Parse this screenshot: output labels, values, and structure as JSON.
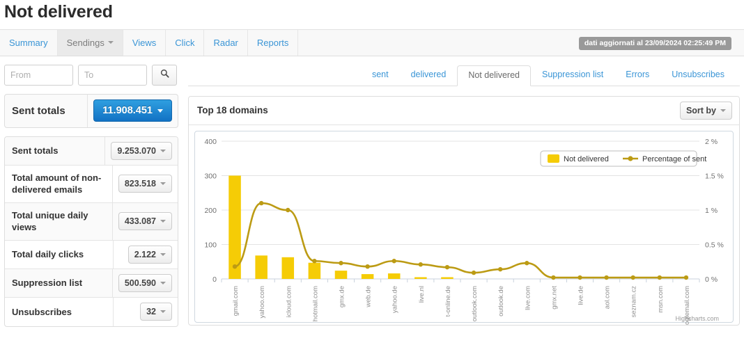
{
  "page": {
    "title": "Not delivered"
  },
  "navbar": {
    "tabs": [
      {
        "label": "Summary",
        "active": false,
        "caret": false
      },
      {
        "label": "Sendings",
        "active": true,
        "caret": true
      },
      {
        "label": "Views",
        "active": false,
        "caret": false
      },
      {
        "label": "Click",
        "active": false,
        "caret": false
      },
      {
        "label": "Radar",
        "active": false,
        "caret": false
      },
      {
        "label": "Reports",
        "active": false,
        "caret": false
      }
    ],
    "update_badge": "dati aggiornati al 23/09/2024 02:25:49 PM"
  },
  "filter": {
    "from_placeholder": "From",
    "from_value": "",
    "to_placeholder": "To",
    "to_value": "",
    "search_icon": "search-icon"
  },
  "sent_totals_header": {
    "label": "Sent totals",
    "value": "11.908.451"
  },
  "stats": [
    {
      "name": "Sent totals",
      "value": "9.253.070"
    },
    {
      "name": "Total amount of non-delivered emails",
      "value": "823.518"
    },
    {
      "name": "Total unique daily views",
      "value": "433.087"
    },
    {
      "name": "Total daily clicks",
      "value": "2.122"
    },
    {
      "name": "Suppression list",
      "value": "500.590"
    },
    {
      "name": "Unsubscribes",
      "value": "32"
    }
  ],
  "subtabs": [
    {
      "label": "sent",
      "active": false
    },
    {
      "label": "delivered",
      "active": false
    },
    {
      "label": "Not delivered",
      "active": true
    },
    {
      "label": "Suppression list",
      "active": false
    },
    {
      "label": "Errors",
      "active": false
    },
    {
      "label": "Unsubscribes",
      "active": false
    }
  ],
  "panel": {
    "title": "Top 18 domains",
    "sort_by_label": "Sort by"
  },
  "chart_data": {
    "type": "bar",
    "title": "Top 18 domains",
    "credit": "Highcharts.com",
    "categories": [
      "gmail.com",
      "yahoo.com",
      "icloud.com",
      "hotmail.com",
      "gmx.de",
      "web.de",
      "yahoo.de",
      "live.nl",
      "t-online.de",
      "outlook.com",
      "outlook.de",
      "live.com",
      "gmx.net",
      "live.de",
      "aol.com",
      "seznam.cz",
      "msn.com",
      "googlemail.com"
    ],
    "series": [
      {
        "name": "Not delivered",
        "type": "column",
        "color": "#F5CC06",
        "axis": "left",
        "values": [
          300,
          68,
          63,
          47,
          24,
          14,
          16,
          4,
          4,
          0,
          0,
          0,
          0,
          0,
          0,
          0,
          0,
          0
        ]
      },
      {
        "name": "Percentage of sent",
        "type": "line",
        "color": "#BC9B14",
        "axis": "right",
        "values": [
          0.18,
          1.1,
          1.0,
          0.26,
          0.23,
          0.18,
          0.26,
          0.21,
          0.17,
          0.09,
          0.14,
          0.23,
          0.02,
          0.02,
          0.02,
          0.02,
          0.02,
          0.02
        ]
      }
    ],
    "ylabel": "",
    "ylim": [
      0,
      400
    ],
    "yticks": [
      "0",
      "100",
      "200",
      "300",
      "400"
    ],
    "y2lim": [
      0,
      2
    ],
    "y2ticks": [
      "0 %",
      "0.5 %",
      "1 %",
      "1.5 %",
      "2 %"
    ],
    "xlabel": "",
    "grid": true,
    "legend": {
      "position": "top-right",
      "entries": [
        "Not delivered",
        "Percentage of sent"
      ]
    }
  }
}
